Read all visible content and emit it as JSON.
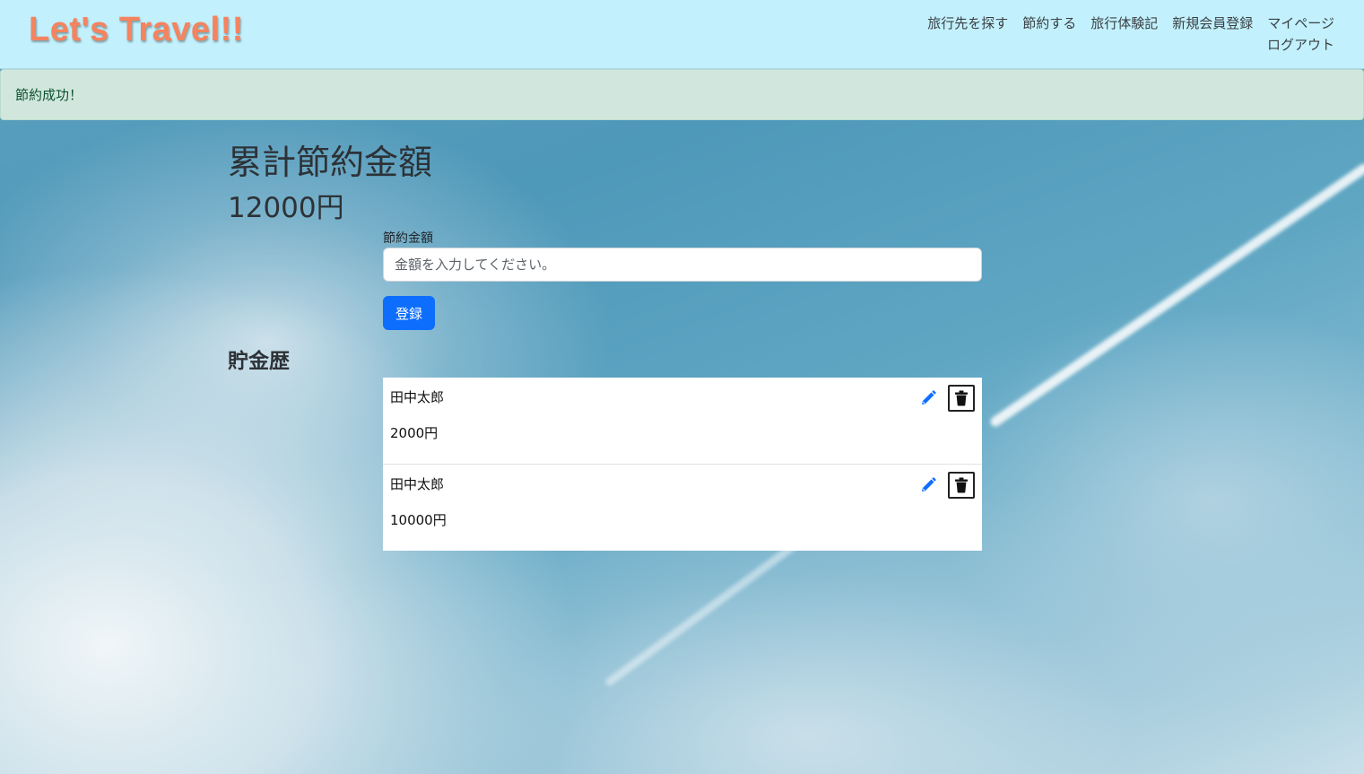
{
  "header": {
    "brand": "Let's Travel!!",
    "nav": [
      "旅行先を探す",
      "節約する",
      "旅行体験記",
      "新規会員登録",
      "マイページ",
      "ログアウト"
    ]
  },
  "flash": {
    "message": "節約成功！"
  },
  "main": {
    "title": "累計節約金額",
    "total": "12000円",
    "form": {
      "label": "節約金額",
      "placeholder": "金額を入力してください。",
      "value": "",
      "submit_label": "登録"
    },
    "history_title": "貯金歴",
    "history": [
      {
        "name": "田中太郎",
        "amount": "2000円"
      },
      {
        "name": "田中太郎",
        "amount": "10000円"
      }
    ]
  },
  "colors": {
    "navbar_bg": "#c2f1fd",
    "brand": "#f4845f",
    "alert_bg": "#d1e7dd",
    "primary": "#0d6efd",
    "edit_icon": "#0d6efd"
  },
  "icons": {
    "edit": "pencil-icon",
    "delete": "trash-icon"
  }
}
